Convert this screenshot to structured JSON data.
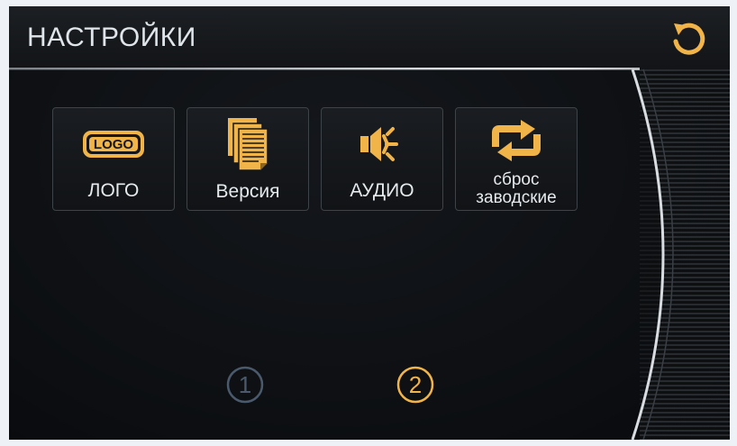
{
  "header": {
    "title": "НАСТРОЙКИ"
  },
  "tiles": [
    {
      "id": "logo",
      "label": "ЛОГО",
      "icon": "logo-icon",
      "icon_text": "LOGO"
    },
    {
      "id": "version",
      "label": "Версия",
      "icon": "document-icon"
    },
    {
      "id": "audio",
      "label": "АУДИО",
      "icon": "speaker-icon"
    },
    {
      "id": "factory-reset",
      "label_line1": "сброс",
      "label_line2": "заводские",
      "icon": "refresh-icon"
    }
  ],
  "pagination": {
    "pages": [
      "1",
      "2"
    ],
    "active_page": "2"
  },
  "colors": {
    "accent": "#f0b449",
    "inactive_page": "#4a5a6c",
    "text": "#e6eaee"
  }
}
